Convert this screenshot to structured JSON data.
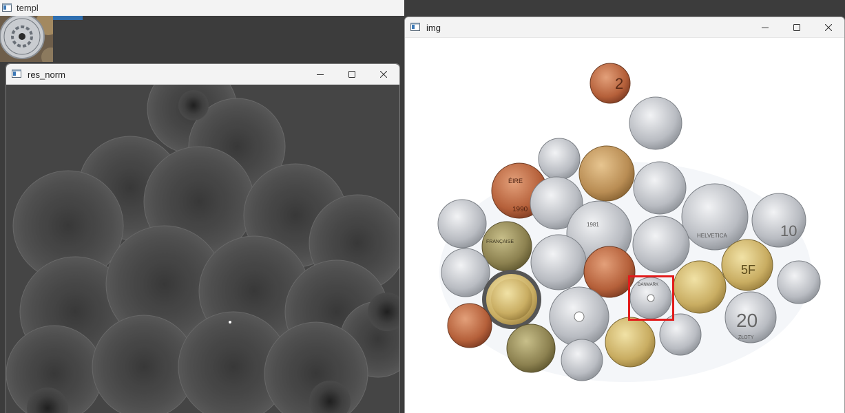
{
  "windows": {
    "templ": {
      "title": "templ",
      "icon": "app-icon"
    },
    "res_norm": {
      "title": "res_norm",
      "icon": "app-icon",
      "controls": [
        "minimize-icon",
        "maximize-icon",
        "close-icon"
      ]
    },
    "img": {
      "title": "img",
      "icon": "app-icon",
      "controls": [
        "minimize-icon",
        "maximize-icon",
        "close-icon"
      ],
      "match_color": "#e21b1b"
    }
  },
  "coin_labels": {
    "c2_ireland": "2",
    "c20_zloty": "20",
    "c10": "10",
    "c5": "5F",
    "eire": "ÉIRE",
    "francaise": "FRANÇAISE",
    "helvetica": "HELVETICA",
    "zloty": "ZŁOTY",
    "danmark": "DANMARK",
    "year1990": "1990",
    "year1981": "1981"
  },
  "colors": {
    "desktop": "#3c3c3c",
    "titlebar": "#f3f3f3",
    "accent": "#2f6fb0",
    "match_box": "#e21b1b"
  }
}
